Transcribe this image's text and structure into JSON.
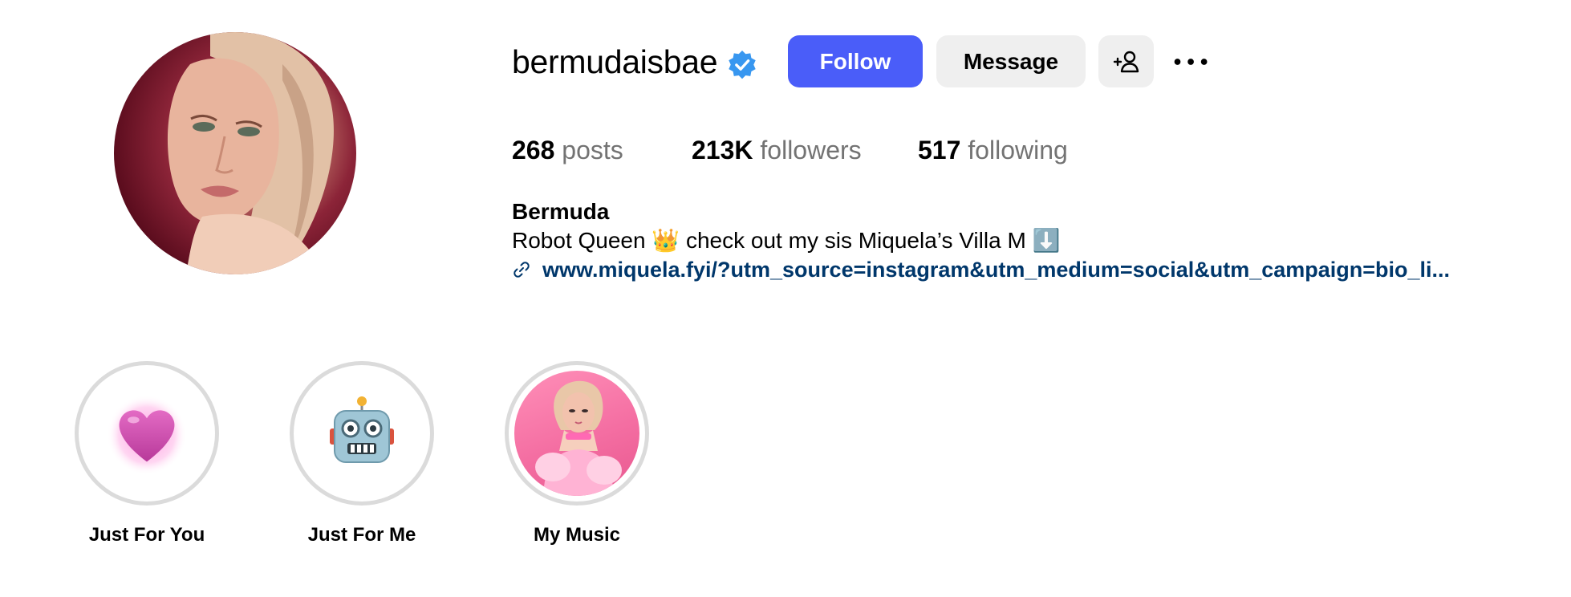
{
  "profile": {
    "username": "bermudaisbae",
    "verified_icon": "verified-badge-icon",
    "avatar_icon": "profile-photo",
    "full_name": "Bermuda",
    "bio": "Robot Queen 👑 check out my sis Miquela’s Villa M ⬇️",
    "link": "www.miquela.fyi/?utm_source=instagram&utm_medium=social&utm_campaign=bio_li...",
    "link_icon": "link-icon"
  },
  "actions": {
    "follow_label": "Follow",
    "message_label": "Message",
    "suggest_icon": "add-person-icon",
    "more_icon": "more-options-icon"
  },
  "stats": {
    "posts": {
      "count": "268",
      "label": "posts"
    },
    "followers": {
      "count": "213K",
      "label": "followers"
    },
    "following": {
      "count": "517",
      "label": "following"
    }
  },
  "highlights": [
    {
      "label": "Just For You",
      "icon": "pink-heart-icon"
    },
    {
      "label": "Just For Me",
      "icon": "robot-icon"
    },
    {
      "label": "My Music",
      "icon": "highlight-photo"
    }
  ],
  "colors": {
    "follow_button": "#4a5df9",
    "secondary_button": "#efefef",
    "link": "#00376b",
    "muted_text": "#737373",
    "verified_badge": "#3897f0",
    "highlight_ring": "#dbdbdb"
  }
}
